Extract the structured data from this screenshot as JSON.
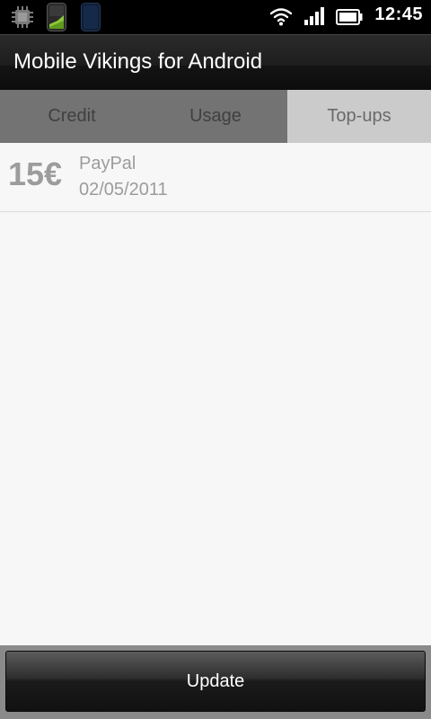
{
  "status_bar": {
    "time": "12:45",
    "icons": [
      "notification-chip-icon",
      "app-notification-icon",
      "app-notification-icon",
      "wifi-icon",
      "cell-signal-icon",
      "battery-icon"
    ]
  },
  "app": {
    "title": "Mobile Vikings for Android"
  },
  "tabs": [
    {
      "label": "Credit",
      "active": false
    },
    {
      "label": "Usage",
      "active": false
    },
    {
      "label": "Top-ups",
      "active": true
    }
  ],
  "topups": [
    {
      "amount": "15€",
      "method": "PayPal",
      "date": "02/05/2011"
    }
  ],
  "footer": {
    "update_label": "Update"
  },
  "colors": {
    "tab_inactive_bg": "#737373",
    "tab_active_bg": "#cbcbcb",
    "list_bg": "#f7f7f7",
    "list_text": "#9c9c9c"
  }
}
